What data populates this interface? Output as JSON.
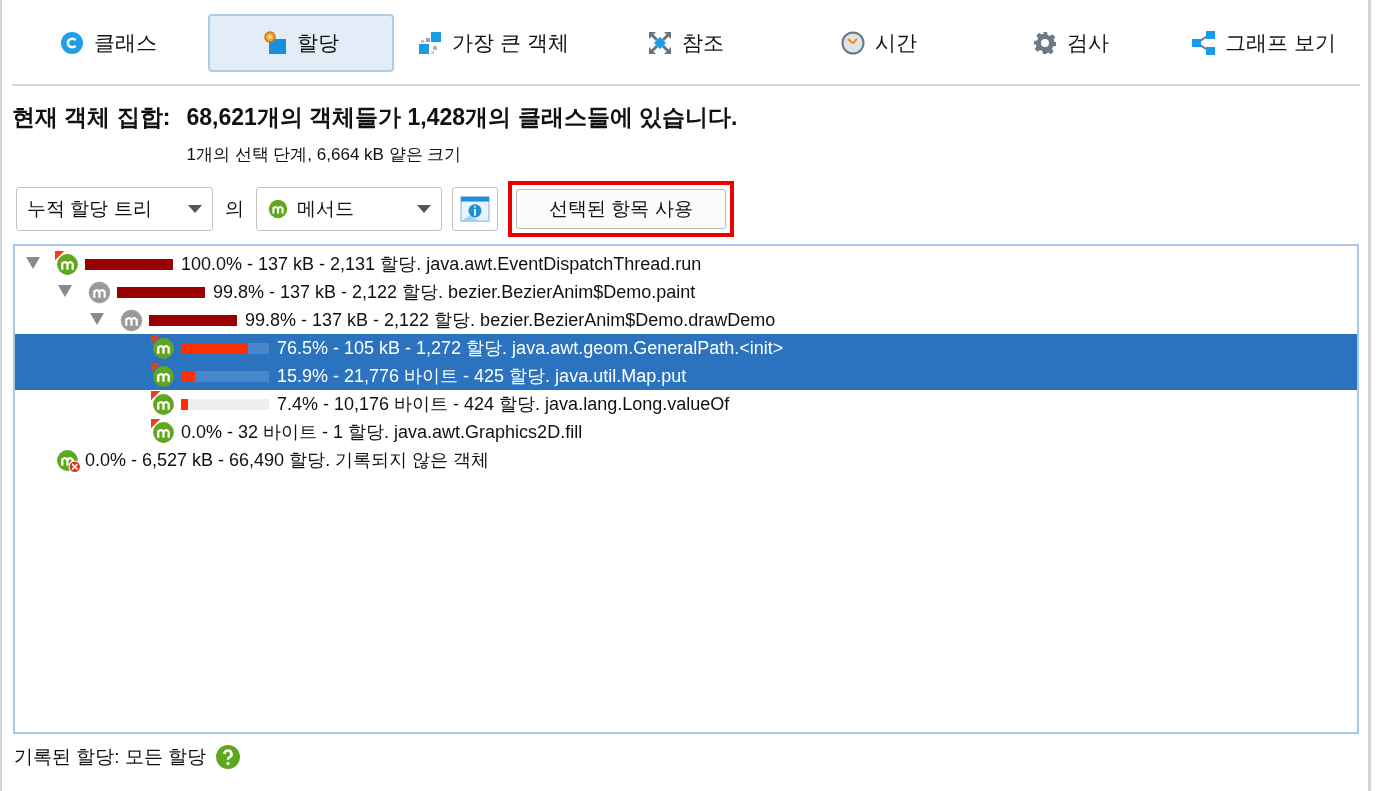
{
  "tabs": [
    {
      "label": "클래스",
      "selected": false
    },
    {
      "label": "할당",
      "selected": true
    },
    {
      "label": "가장 큰 객체",
      "selected": false
    },
    {
      "label": "참조",
      "selected": false
    },
    {
      "label": "시간",
      "selected": false
    },
    {
      "label": "검사",
      "selected": false
    },
    {
      "label": "그래프 보기",
      "selected": false
    }
  ],
  "header": {
    "title_label": "현재 객체 집합:",
    "title_value": "68,621개의 객체들가 1,428개의 클래스들에 있습니다.",
    "subtitle": "1개의 선택 단계, 6,664 kB 얕은 크기"
  },
  "toolbar": {
    "view_dropdown": {
      "value": "누적 할당 트리"
    },
    "connector": "의",
    "aggregation_dropdown": {
      "value": "메서드"
    },
    "use_selected_button": {
      "label": "선택된 항목 사용",
      "highlighted": true
    }
  },
  "tree": [
    {
      "text": "100.0% - 137 kB - 2,131 할당. java.awt.EventDispatchThread.run",
      "level": 1.0,
      "kind": "method",
      "hotspot": true,
      "expanded": true,
      "selected": false,
      "children": [
        {
          "text": "99.8% - 137 kB - 2,122 할당. bezier.BezierAnim$Demo.paint",
          "level": 0.998,
          "kind": "inactive",
          "hotspot": false,
          "expanded": true,
          "selected": false,
          "children": [
            {
              "text": "99.8% - 137 kB - 2,122 할당. bezier.BezierAnim$Demo.drawDemo",
              "level": 0.998,
              "kind": "inactive",
              "hotspot": false,
              "expanded": true,
              "selected": false,
              "children": [
                {
                  "text": "76.5% - 105 kB - 1,272 할당. java.awt.geom.GeneralPath.<init>",
                  "level": 0.765,
                  "kind": "method",
                  "hotspot": true,
                  "selected": true
                },
                {
                  "text": "15.9% - 21,776 바이트 - 425 할당. java.util.Map.put",
                  "level": 0.159,
                  "kind": "method",
                  "hotspot": true,
                  "selected": true
                },
                {
                  "text": "7.4% - 10,176 바이트 - 424 할당. java.lang.Long.valueOf",
                  "level": 0.074,
                  "kind": "method",
                  "hotspot": true,
                  "selected": false
                },
                {
                  "text": "0.0% - 32 바이트 - 1 할당. java.awt.Graphics2D.fill",
                  "kind": "method",
                  "hotspot": true,
                  "selected": false
                }
              ]
            }
          ]
        }
      ]
    },
    {
      "text": "0.0% - 6,527 kB - 66,490 할당. 기록되지 않은 객체",
      "kind": "unrecorded",
      "hotspot": false,
      "selected": false
    }
  ],
  "footer": {
    "text": "기록된 할당: 모든 할당"
  }
}
